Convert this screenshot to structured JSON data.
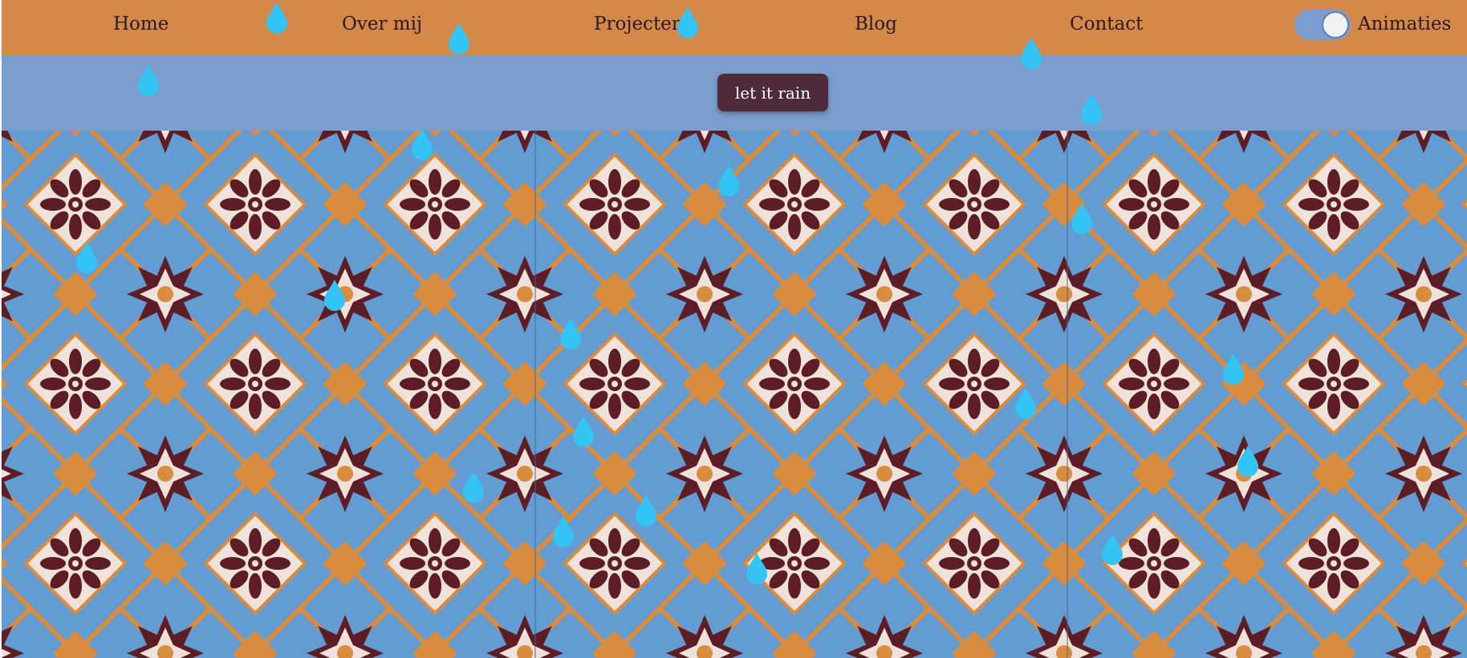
{
  "nav": {
    "items": [
      {
        "label": "Home"
      },
      {
        "label": "Over mij"
      },
      {
        "label": "Projecten"
      },
      {
        "label": "Blog"
      },
      {
        "label": "Contact"
      }
    ],
    "animations_toggle": {
      "label": "Animaties",
      "state": "on"
    }
  },
  "banner": {
    "button_label": "let it rain"
  },
  "colors": {
    "nav_background": "#d4884a",
    "banner_background": "#7a9ecd",
    "button_background": "#4e2a3a",
    "raindrop": "#33c4f5",
    "tile_blue": "#5b94cf",
    "tile_orange": "#d98c3e",
    "tile_maroon": "#5c1e24",
    "tile_cream": "#efe2da"
  },
  "icons": {
    "raindrop": "raindrop-icon",
    "tile_pattern": "azulejo-tile-pattern"
  }
}
